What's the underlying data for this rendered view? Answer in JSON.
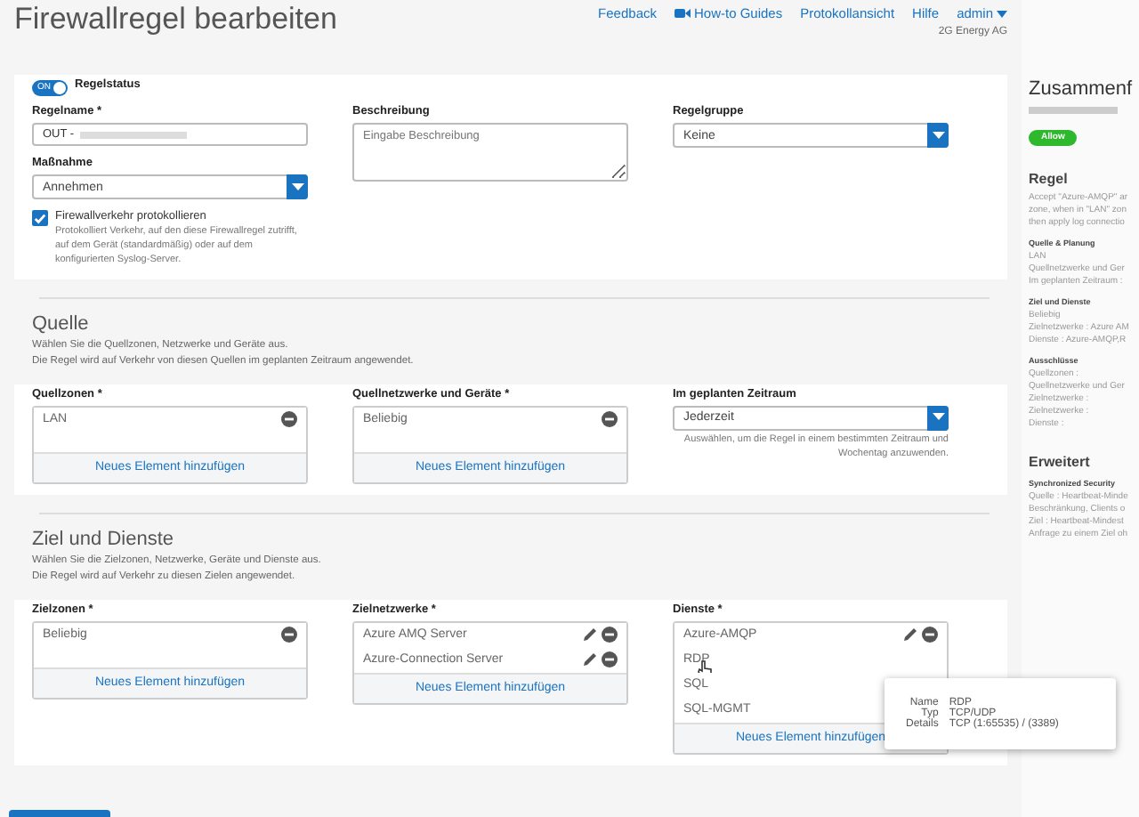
{
  "header": {
    "title": "Firewallregel bearbeiten",
    "links": [
      {
        "label": "Feedback",
        "kind": "text"
      },
      {
        "label": "How-to Guides",
        "kind": "video"
      },
      {
        "label": "Protokollansicht",
        "kind": "text"
      },
      {
        "label": "Hilfe",
        "kind": "text"
      }
    ],
    "user": "admin",
    "org": "2G Energy AG"
  },
  "general": {
    "status": {
      "label": "Regelstatus",
      "toggle_text": "ON",
      "on": true
    },
    "name": {
      "label": "Regelname *",
      "value": "OUT -"
    },
    "action": {
      "label": "Maßnahme",
      "value": "Annehmen"
    },
    "log": {
      "label": "Firewallverkehr protokollieren",
      "checked": true,
      "help": "Protokolliert Verkehr, auf den diese Firewallregel zutrifft, auf dem Gerät (standardmäßig) oder auf dem konfigurierten Syslog-Server."
    },
    "description": {
      "label": "Beschreibung",
      "placeholder": "Eingabe Beschreibung"
    },
    "group": {
      "label": "Regelgruppe",
      "value": "Keine"
    }
  },
  "source": {
    "title": "Quelle",
    "lines": [
      "Wählen Sie die Quellzonen, Netzwerke und Geräte aus.",
      "Die Regel wird auf Verkehr von diesen Quellen im geplanten Zeitraum angewendet."
    ],
    "columns": [
      {
        "kind": "list",
        "label": "Quellzonen *",
        "items": [
          {
            "name": "LAN",
            "editable": false
          }
        ],
        "add": "Neues Element hinzufügen"
      },
      {
        "kind": "list",
        "label": "Quellnetzwerke und Geräte *",
        "items": [
          {
            "name": "Beliebig",
            "editable": false
          }
        ],
        "add": "Neues Element hinzufügen"
      },
      {
        "kind": "select",
        "label": "Im geplanten Zeitraum",
        "value": "Jederzeit",
        "help": "Auswählen, um die Regel in einem bestimmten Zeitraum und Wochentag anzuwenden."
      }
    ]
  },
  "destination": {
    "title": "Ziel und Dienste",
    "lines": [
      "Wählen Sie die Zielzonen, Netzwerke, Geräte und Dienste aus.",
      "Die Regel wird auf Verkehr zu diesen Zielen angewendet."
    ],
    "columns": [
      {
        "kind": "list",
        "label": "Zielzonen *",
        "items": [
          {
            "name": "Beliebig",
            "editable": false
          }
        ],
        "add": "Neues Element hinzufügen"
      },
      {
        "kind": "list",
        "label": "Zielnetzwerke *",
        "items": [
          {
            "name": "Azure AMQ Server",
            "editable": true
          },
          {
            "name": "Azure-Connection Server",
            "editable": true
          }
        ],
        "add": "Neues Element hinzufügen"
      },
      {
        "kind": "list",
        "label": "Dienste *",
        "items": [
          {
            "name": "Azure-AMQP",
            "editable": true
          },
          {
            "name": "RDP"
          },
          {
            "name": "SQL"
          },
          {
            "name": "SQL-MGMT"
          }
        ],
        "add": "Neues Element hinzufügen"
      }
    ]
  },
  "tooltip": {
    "rows": [
      {
        "key": "Name",
        "value": "RDP"
      },
      {
        "key": "Typ",
        "value": "TCP/UDP"
      },
      {
        "key": "Details",
        "value": "TCP (1:65535) / (3389)"
      }
    ]
  },
  "summary": {
    "title": "Zusammenf",
    "action": "Allow",
    "sections": [
      {
        "kind": "major",
        "title": "Regel",
        "lines": [
          "Accept \"Azure-AMQP\" ar",
          "zone, when in \"LAN\" zon",
          "then apply log connectio"
        ]
      },
      {
        "kind": "minor",
        "title": "Quelle & Planung",
        "lines": [
          "LAN",
          "Quellnetzwerke und Ger",
          "Im geplanten Zeitraum :"
        ]
      },
      {
        "kind": "minor",
        "title": "Ziel und Dienste",
        "lines": [
          "Beliebig",
          "Zielnetzwerke : Azure AM",
          "Dienste : Azure-AMQP,R"
        ]
      },
      {
        "kind": "minor",
        "title": "Ausschlüsse",
        "lines": [
          "Quellzonen :",
          "Quellnetzwerke und Ger",
          "Zielnetzwerke :",
          "Zielnetzwerke :",
          "Dienste :"
        ]
      },
      {
        "kind": "major",
        "title": "Erweitert"
      },
      {
        "kind": "minor",
        "title": "Synchronized Security",
        "lines": [
          "Quelle : Heartbeat-Minde",
          "Beschränkung, Clients o",
          "Ziel : Heartbeat-Mindest",
          "Anfrage zu einem Ziel oh"
        ]
      }
    ]
  }
}
